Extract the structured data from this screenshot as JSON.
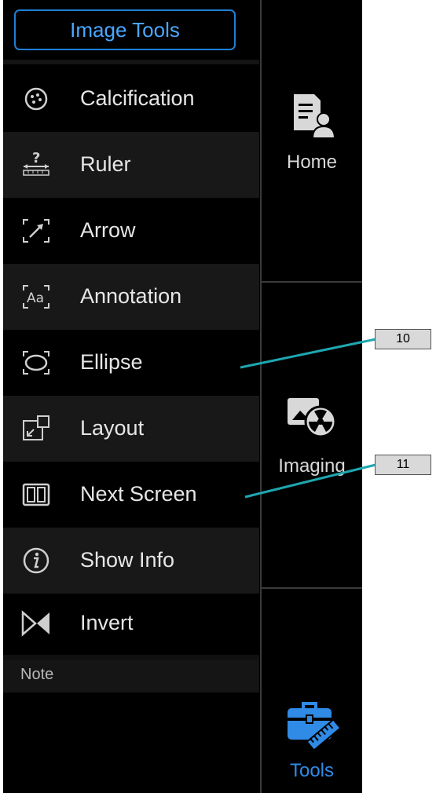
{
  "header": {
    "title": "Image Tools"
  },
  "tools": [
    {
      "label": "Calcification",
      "icon": "calcification-icon"
    },
    {
      "label": "Ruler",
      "icon": "ruler-icon"
    },
    {
      "label": "Arrow",
      "icon": "arrow-icon"
    },
    {
      "label": "Annotation",
      "icon": "annotation-icon"
    },
    {
      "label": "Ellipse",
      "icon": "ellipse-icon"
    },
    {
      "label": "Layout",
      "icon": "layout-icon"
    },
    {
      "label": "Next Screen",
      "icon": "next-screen-icon"
    },
    {
      "label": "Show Info",
      "icon": "info-icon"
    },
    {
      "label": "Invert",
      "icon": "invert-icon"
    }
  ],
  "note": {
    "label": "Note"
  },
  "nav": [
    {
      "label": "Home",
      "icon": "home-document-icon"
    },
    {
      "label": "Imaging",
      "icon": "imaging-radiation-icon"
    },
    {
      "label": "Tools",
      "icon": "toolbox-icon",
      "active": true
    }
  ],
  "callouts": [
    "10",
    "11"
  ],
  "colors": {
    "accent": "#2f8be6",
    "callout_line": "#1ea7b0",
    "background": "#000000"
  }
}
